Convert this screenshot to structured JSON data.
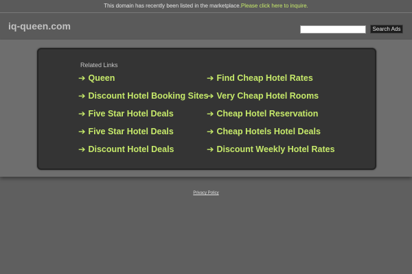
{
  "topbar": {
    "notice": "This domain has recently been listed in the marketplace.",
    "link_text": "Please click here to inquire."
  },
  "header": {
    "domain": "iq-queen.com",
    "search_placeholder": "",
    "search_button": "Search Ads"
  },
  "links_panel": {
    "heading": "Related Links",
    "arrow_glyph": "➔",
    "left_column": [
      "Queen",
      "Discount Hotel Booking Sites",
      "Five Star Hotel Deals",
      "Five Star Hotel Deals",
      "Discount Hotel Deals"
    ],
    "right_column": [
      "Find Cheap Hotel Rates",
      "Very Cheap Hotel Rooms",
      "Cheap Hotel Reservation",
      "Cheap Hotels Hotel Deals",
      "Discount Weekly Hotel Rates"
    ]
  },
  "footer": {
    "privacy": "Privacy Policy"
  },
  "colors": {
    "background": "#5f5f5f",
    "panel": "#343434",
    "link": "#c6e96a"
  }
}
